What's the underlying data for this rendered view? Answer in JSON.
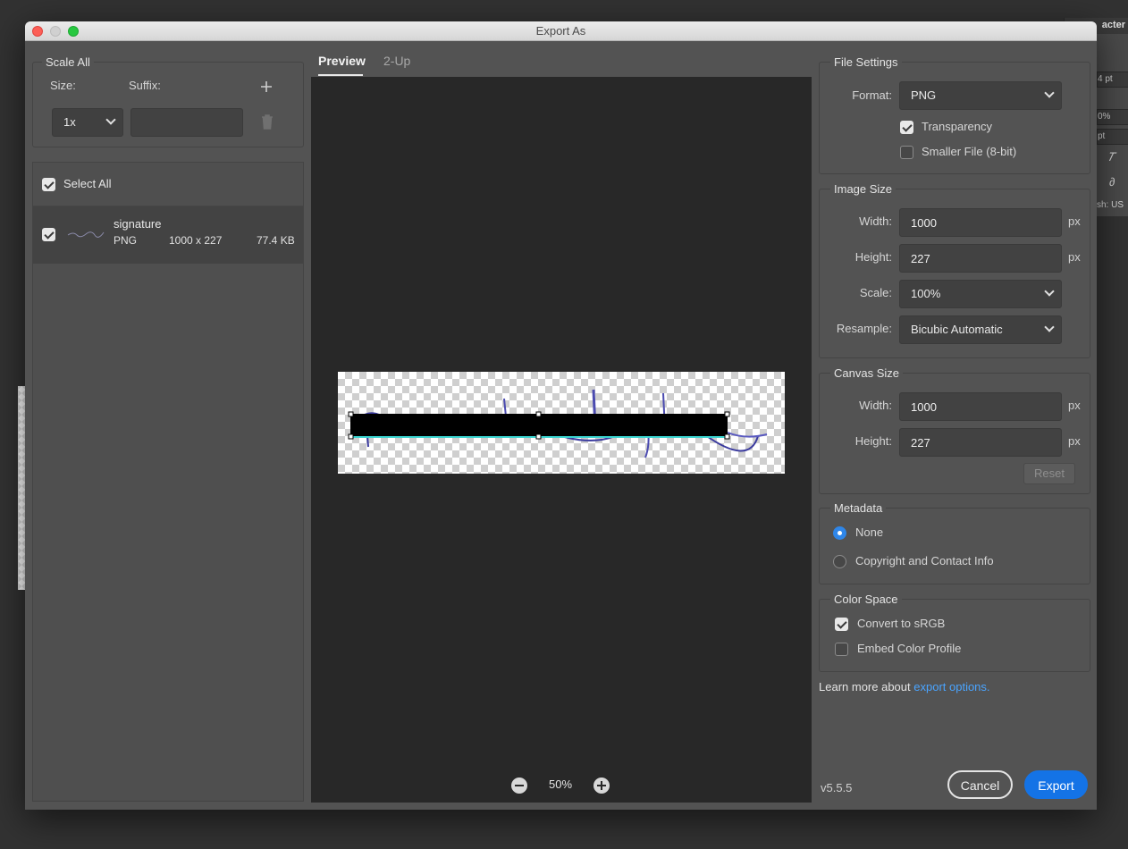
{
  "background_panel": {
    "tab_label": "acter",
    "size_value": "4 pt",
    "percent_value": "0%",
    "pt_value": "pt",
    "lang_value": "sh: US"
  },
  "dialog": {
    "title": "Export As"
  },
  "scale_all": {
    "legend": "Scale All",
    "size_label": "Size:",
    "suffix_label": "Suffix:",
    "size_value": "1x",
    "suffix_value": ""
  },
  "assets": {
    "select_all_label": "Select All",
    "select_all_checked": true,
    "items": [
      {
        "name": "signature",
        "format": "PNG",
        "dimensions": "1000 x 227",
        "filesize": "77.4 KB",
        "checked": true
      }
    ]
  },
  "preview": {
    "tabs": [
      {
        "label": "Preview",
        "active": true
      },
      {
        "label": "2-Up",
        "active": false
      }
    ],
    "zoom": "50%"
  },
  "file_settings": {
    "legend": "File Settings",
    "format_label": "Format:",
    "format_value": "PNG",
    "transparency_label": "Transparency",
    "transparency_checked": true,
    "smaller_file_label": "Smaller File (8-bit)",
    "smaller_file_checked": false
  },
  "image_size": {
    "legend": "Image Size",
    "width_label": "Width:",
    "width_value": "1000",
    "height_label": "Height:",
    "height_value": "227",
    "scale_label": "Scale:",
    "scale_value": "100%",
    "resample_label": "Resample:",
    "resample_value": "Bicubic Automatic",
    "unit": "px"
  },
  "canvas_size": {
    "legend": "Canvas Size",
    "width_label": "Width:",
    "width_value": "1000",
    "height_label": "Height:",
    "height_value": "227",
    "unit": "px",
    "reset_label": "Reset"
  },
  "metadata": {
    "legend": "Metadata",
    "options": [
      {
        "label": "None",
        "selected": true
      },
      {
        "label": "Copyright and Contact Info",
        "selected": false
      }
    ]
  },
  "color_space": {
    "legend": "Color Space",
    "convert_label": "Convert to sRGB",
    "convert_checked": true,
    "embed_label": "Embed Color Profile",
    "embed_checked": false
  },
  "footer": {
    "learn_more_prefix": "Learn more about",
    "learn_more_link": "export options.",
    "version": "v5.5.5",
    "cancel_label": "Cancel",
    "export_label": "Export"
  },
  "colors": {
    "accent": "#1473e6",
    "link": "#4aa4ff",
    "panel": "#535353",
    "preview_bg": "#282828"
  }
}
